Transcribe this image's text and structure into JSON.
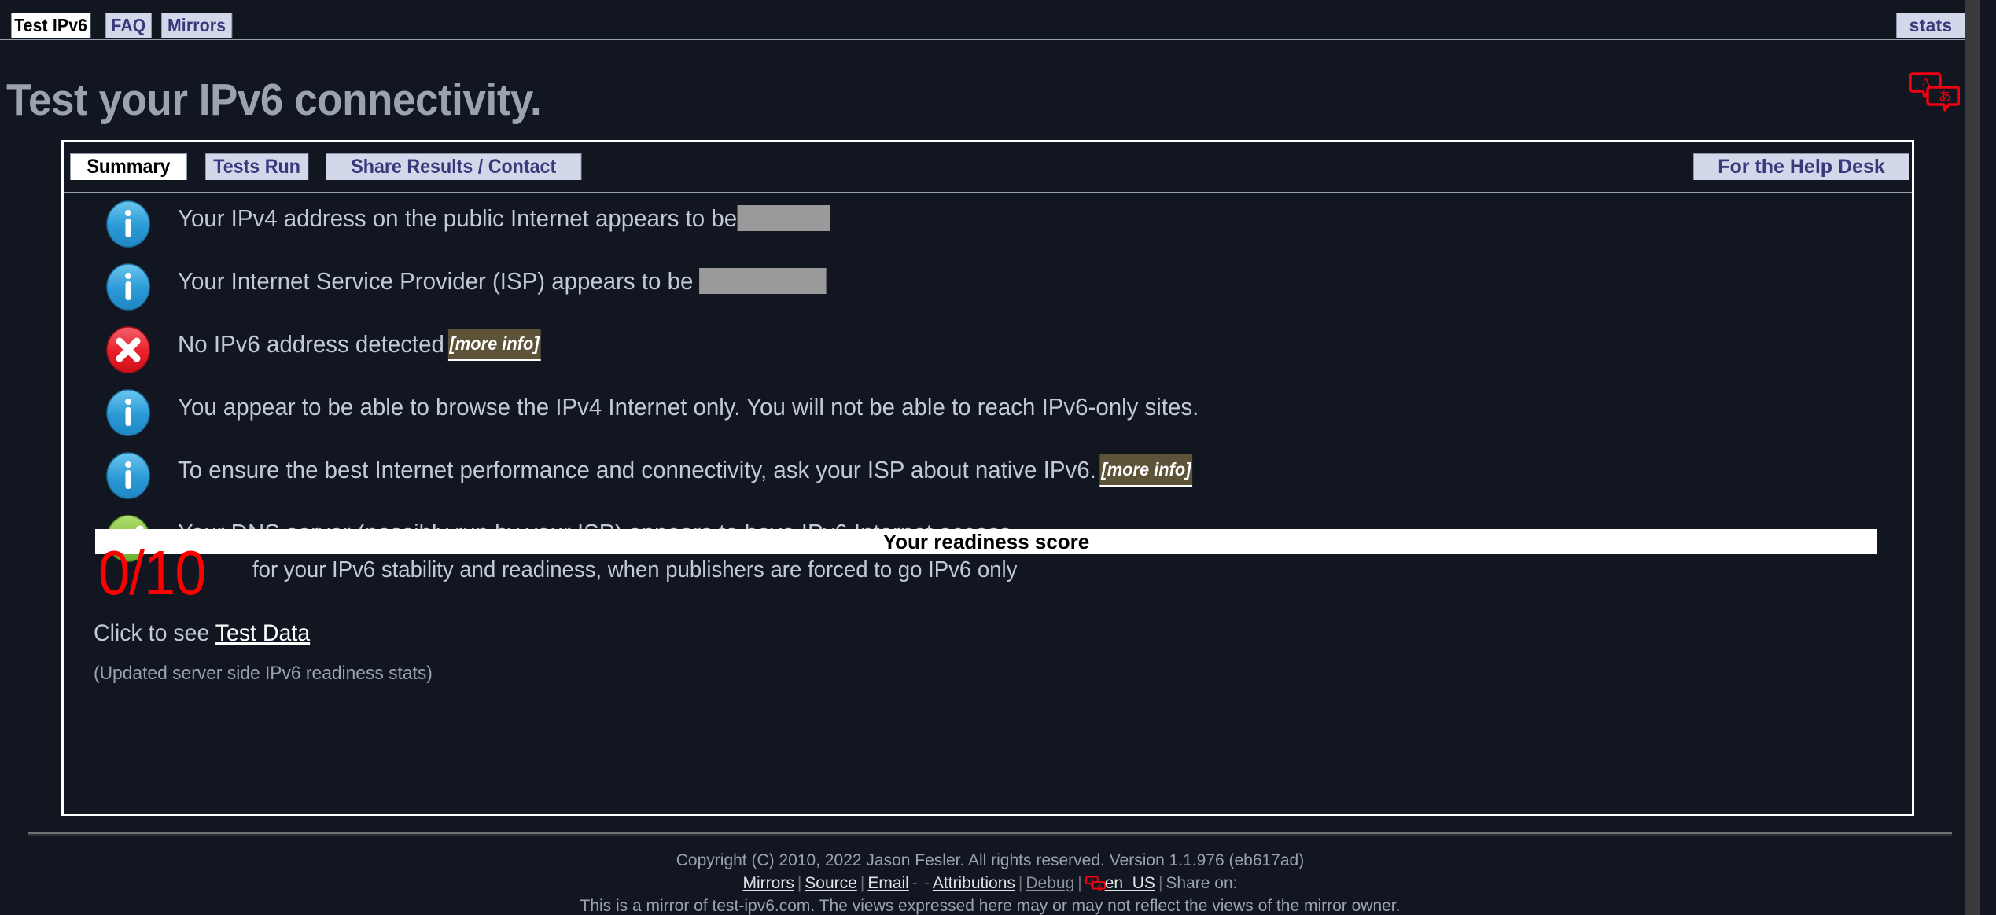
{
  "topnav": {
    "tabs": [
      {
        "label": "Test IPv6",
        "active": true
      },
      {
        "label": "FAQ",
        "active": false
      },
      {
        "label": "Mirrors",
        "active": false
      }
    ],
    "stats_label": "stats",
    "translate_icon": "translate-icon"
  },
  "headline": "Test your IPv6 connectivity.",
  "panel": {
    "tabs": [
      {
        "label": "Summary",
        "active": true
      },
      {
        "label": "Tests Run",
        "active": false
      },
      {
        "label": "Share Results / Contact",
        "active": false
      }
    ],
    "help_desk_label": "For the Help Desk"
  },
  "results": [
    {
      "icon": "info-icon",
      "icon_kind": "info",
      "text_before": "Your IPv4 address on the public Internet appears to be",
      "redacted": true,
      "redact_width": 124,
      "text_after": "",
      "more_info": null
    },
    {
      "icon": "info-icon",
      "icon_kind": "info",
      "text_before": "Your Internet Service Provider (ISP) appears to be ",
      "redacted": true,
      "redact_width": 170,
      "text_after": "",
      "more_info": null
    },
    {
      "icon": "error-icon",
      "icon_kind": "error",
      "text_before": "No IPv6 address detected",
      "redacted": false,
      "redact_width": 0,
      "text_after": "",
      "more_info": "[more info]"
    },
    {
      "icon": "info-icon",
      "icon_kind": "info",
      "text_before": "You appear to be able to browse the IPv4 Internet only. You will not be able to reach IPv6-only sites.",
      "redacted": false,
      "redact_width": 0,
      "text_after": "",
      "more_info": null
    },
    {
      "icon": "info-icon",
      "icon_kind": "info",
      "text_before": "To ensure the best Internet performance and connectivity, ask your ISP about native IPv6.",
      "redacted": false,
      "redact_width": 0,
      "text_after": "",
      "more_info": "[more info]"
    },
    {
      "icon": "success-icon",
      "icon_kind": "success",
      "text_before": "Your DNS server (possibly run by your ISP) appears to have IPv6 Internet access.",
      "redacted": false,
      "redact_width": 0,
      "text_after": "",
      "more_info": null
    }
  ],
  "score": {
    "bar_title": "Your readiness score",
    "value": "0/10",
    "caption": "for your IPv6 stability and readiness, when publishers are forced to go IPv6 only",
    "color": "#ff0000"
  },
  "bottom": {
    "click_prefix": "Click to see ",
    "click_link": "Test Data",
    "updated_note": "(Updated server side IPv6 readiness stats)"
  },
  "footer": {
    "copyright": "Copyright (C) 2010, 2022 Jason Fesler. All rights reserved. Version 1.1.976 (eb617ad)",
    "links": {
      "mirrors": "Mirrors",
      "source": "Source",
      "email": "Email",
      "dash1": "-",
      "dash2": "-",
      "attributions": "Attributions",
      "debug": "Debug",
      "locale": "en_US",
      "share_on": "Share on:"
    },
    "separator": "|",
    "mirror_note": "This is a mirror of test-ipv6.com. The views expressed here may or may not reflect the views of the mirror owner."
  },
  "colors": {
    "background": "#111620",
    "tab_inactive_bg": "#d3d7ea",
    "tab_text": "#37397a",
    "body_text": "#c2cad4",
    "info": "#3aa7dd",
    "error": "#ef2b35",
    "success": "#8ac849",
    "score_red": "#ff0000",
    "redact_gray": "#9a9a9a",
    "more_info_bg": "#5c5338"
  }
}
